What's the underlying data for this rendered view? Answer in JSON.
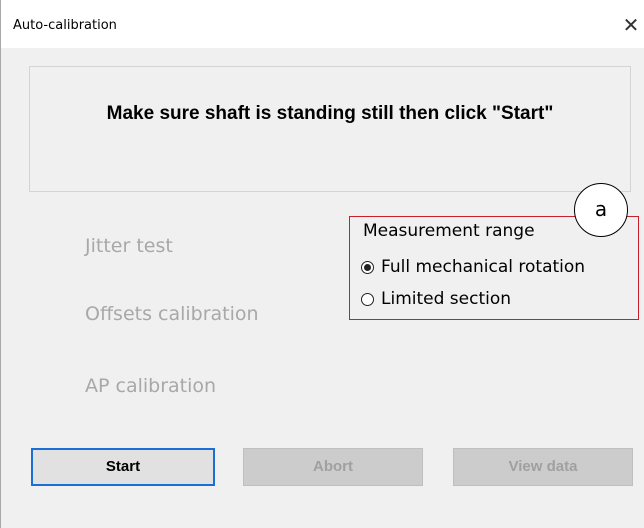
{
  "window": {
    "title": "Auto-calibration",
    "close_glyph": "✕"
  },
  "instruction": {
    "text": "Make sure shaft is standing still then click \"Start\""
  },
  "steps": [
    {
      "label": "Jitter test"
    },
    {
      "label": "Offsets calibration"
    },
    {
      "label": "AP calibration"
    }
  ],
  "measurement_range": {
    "title": "Measurement range",
    "options": [
      {
        "label": "Full mechanical rotation",
        "selected": true
      },
      {
        "label": "Limited section",
        "selected": false
      }
    ]
  },
  "callout": {
    "label": "a"
  },
  "buttons": {
    "start": "Start",
    "abort": "Abort",
    "view_data": "View data"
  },
  "colors": {
    "highlight": "#c8202d",
    "focus_border": "#1a6fd6",
    "disabled_text": "#a8a8a8"
  }
}
